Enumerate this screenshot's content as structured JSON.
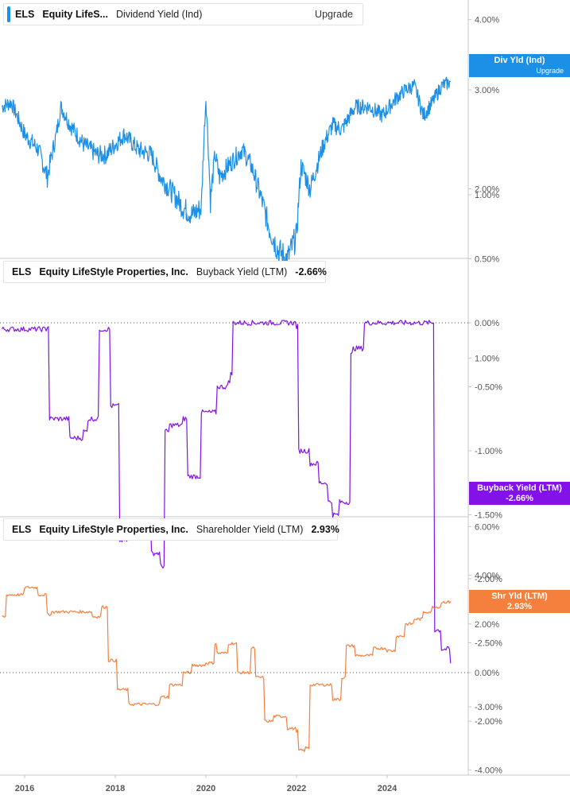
{
  "colors": {
    "div": "#1c8fe6",
    "bb": "#8212e8",
    "shr": "#f5803e",
    "grid": "#c8c8c8",
    "axis_text": "#555555"
  },
  "panel1": {
    "ticker": "ELS",
    "company": "Equity LifeS...",
    "metric": "Dividend Yield (Ind)",
    "upgrade": "Upgrade",
    "badge_label": "Div Yld (Ind)",
    "badge_sub": "Upgrade"
  },
  "panel2": {
    "ticker": "ELS",
    "company": "Equity LifeStyle Properties, Inc.",
    "metric": "Buyback Yield (LTM)",
    "value": "-2.66%",
    "badge_label": "Buyback Yield (LTM)",
    "badge_value": "-2.66%"
  },
  "panel3": {
    "ticker": "ELS",
    "company": "Equity LifeStyle Properties, Inc.",
    "metric": "Shareholder Yield (LTM)",
    "value": "2.93%",
    "badge_label": "Shr Yld (LTM)",
    "badge_value": "2.93%"
  },
  "chart_data": [
    {
      "type": "line",
      "scale": "log",
      "series": [
        {
          "name": "Dividend Yield (Ind)",
          "x": [
            2015.5,
            2015.7,
            2016.0,
            2016.3,
            2016.5,
            2016.7,
            2016.8,
            2017.0,
            2017.3,
            2017.6,
            2017.8,
            2018.0,
            2018.2,
            2018.5,
            2018.8,
            2019.0,
            2019.3,
            2019.5,
            2019.7,
            2019.9,
            2020.0,
            2020.1,
            2020.2,
            2020.3,
            2020.6,
            2020.8,
            2021.0,
            2021.2,
            2021.4,
            2021.6,
            2021.8,
            2022.0,
            2022.1,
            2022.3,
            2022.6,
            2022.8,
            2023.0,
            2023.3,
            2023.6,
            2023.9,
            2024.2,
            2024.4,
            2024.6,
            2024.8,
            2025.0,
            2025.2,
            2025.4
          ],
          "values": [
            2.8,
            2.85,
            2.5,
            2.35,
            2.1,
            2.5,
            2.8,
            2.6,
            2.4,
            2.3,
            2.3,
            2.4,
            2.5,
            2.35,
            2.3,
            2.1,
            1.95,
            1.85,
            1.8,
            1.85,
            2.9,
            1.9,
            2.3,
            2.1,
            2.25,
            2.35,
            2.2,
            1.95,
            1.7,
            1.55,
            1.5,
            1.65,
            2.2,
            2.0,
            2.4,
            2.6,
            2.55,
            2.8,
            2.8,
            2.7,
            2.9,
            3.0,
            3.05,
            2.7,
            2.85,
            3.05,
            3.1
          ]
        }
      ],
      "ticks": [
        "1.00%",
        "2.00%",
        "3.00%",
        "4.00%"
      ]
    },
    {
      "type": "line",
      "series": [
        {
          "name": "Buyback Yield (LTM)",
          "x": [
            2015.5,
            2016.0,
            2016.5,
            2016.55,
            2017.0,
            2017.3,
            2017.4,
            2017.5,
            2017.65,
            2017.75,
            2017.9,
            2018.05,
            2018.1,
            2018.3,
            2018.5,
            2018.8,
            2019.0,
            2019.1,
            2019.2,
            2019.5,
            2019.6,
            2019.75,
            2019.9,
            2020.0,
            2020.2,
            2020.25,
            2020.35,
            2020.5,
            2020.55,
            2020.6,
            2021.0,
            2021.5,
            2022.0,
            2022.05,
            2022.3,
            2022.5,
            2022.7,
            2022.8,
            2022.95,
            2023.0,
            2023.2,
            2023.25,
            2023.5,
            2024.0,
            2024.5,
            2025.0,
            2025.05,
            2025.1,
            2025.2,
            2025.4
          ],
          "values": [
            -0.05,
            -0.05,
            -0.03,
            -0.75,
            -0.9,
            -0.85,
            -0.75,
            -0.75,
            -0.05,
            -0.05,
            -0.65,
            -0.65,
            -1.7,
            -1.6,
            -1.55,
            -1.8,
            -1.9,
            -0.85,
            -0.8,
            -0.75,
            -1.2,
            -1.2,
            -0.7,
            -0.7,
            -0.7,
            -0.5,
            -0.5,
            -0.45,
            -0.4,
            0.0,
            0.0,
            0.0,
            -0.03,
            -1.0,
            -1.1,
            -1.25,
            -1.4,
            -1.5,
            -1.4,
            -1.4,
            -0.25,
            -0.2,
            0.0,
            0.0,
            0.0,
            0.0,
            -2.4,
            -2.4,
            -2.55,
            -2.66
          ]
        }
      ],
      "ticks": [
        "-3.00%",
        "-2.50%",
        "-2.00%",
        "-1.50%",
        "-1.00%",
        "-0.50%",
        "0.00%",
        "0.50%",
        "1.00%"
      ]
    },
    {
      "type": "line",
      "series": [
        {
          "name": "Shareholder Yield (LTM)",
          "x": [
            2015.5,
            2015.6,
            2016.0,
            2016.3,
            2016.5,
            2016.6,
            2017.0,
            2017.3,
            2017.5,
            2017.7,
            2017.8,
            2017.85,
            2018.0,
            2018.05,
            2018.3,
            2018.8,
            2019.0,
            2019.2,
            2019.5,
            2019.7,
            2020.0,
            2020.2,
            2020.25,
            2020.5,
            2020.7,
            2021.0,
            2021.1,
            2021.3,
            2021.5,
            2021.8,
            2022.0,
            2022.05,
            2022.2,
            2022.3,
            2022.5,
            2022.8,
            2023.0,
            2023.1,
            2023.3,
            2023.5,
            2023.7,
            2024.0,
            2024.2,
            2024.4,
            2024.6,
            2024.8,
            2025.0,
            2025.2,
            2025.4
          ],
          "values": [
            2.3,
            3.2,
            3.5,
            3.2,
            2.4,
            2.5,
            2.5,
            2.5,
            2.3,
            2.7,
            2.7,
            0.5,
            0.5,
            -0.7,
            -1.3,
            -1.3,
            -1.0,
            -0.5,
            0.0,
            0.3,
            0.4,
            1.2,
            0.8,
            1.2,
            0.0,
            1.0,
            -0.2,
            -2.0,
            -1.8,
            -2.3,
            -2.4,
            -3.2,
            -3.1,
            -0.5,
            -0.5,
            -1.1,
            -0.2,
            1.1,
            0.7,
            0.7,
            1.0,
            0.9,
            1.5,
            2.0,
            2.2,
            2.5,
            2.7,
            2.9,
            2.93
          ]
        }
      ],
      "ticks": [
        "-4.00%",
        "-2.00%",
        "0.00%",
        "2.00%",
        "4.00%",
        "6.00%"
      ]
    }
  ],
  "x_axis": {
    "ticks": [
      "2016",
      "2018",
      "2020",
      "2022",
      "2024"
    ]
  }
}
